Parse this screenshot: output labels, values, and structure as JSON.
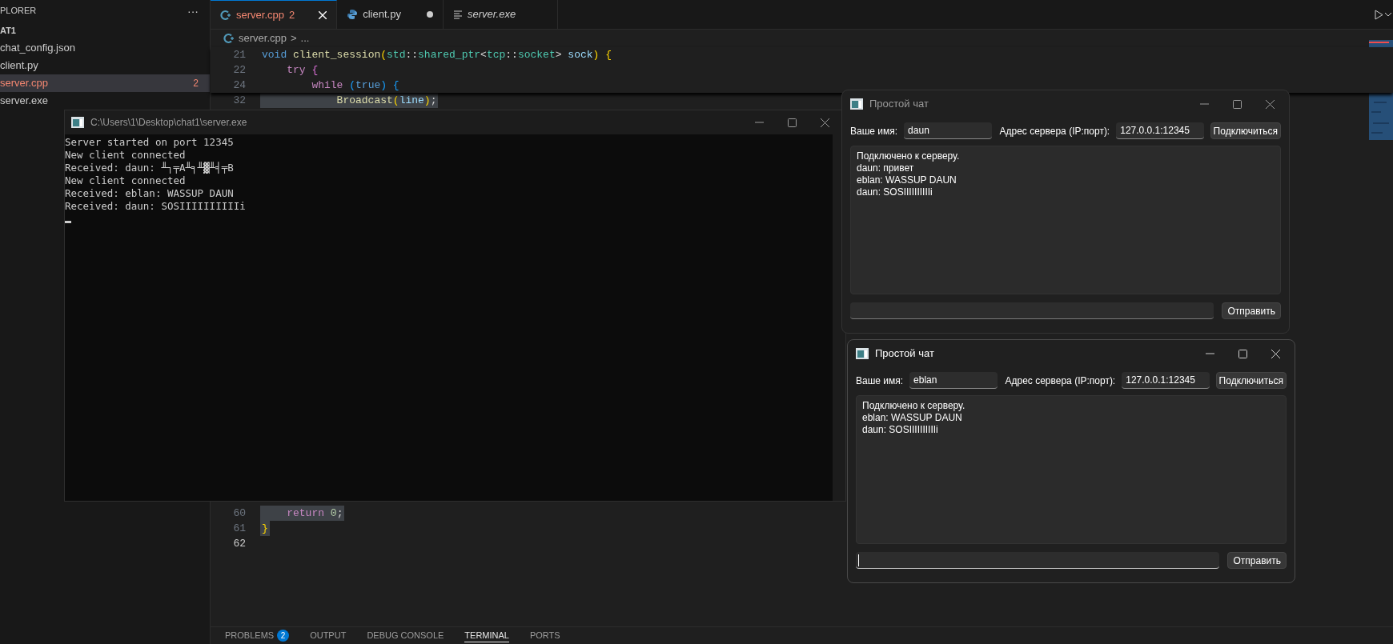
{
  "sidebar": {
    "title": "PLORER",
    "more_icon": "···",
    "section": "AT1",
    "items": [
      {
        "label": "chat_config.json",
        "selected": false
      },
      {
        "label": "client.py",
        "selected": false
      },
      {
        "label": "server.cpp",
        "selected": true,
        "badge": "2"
      },
      {
        "label": "server.exe",
        "selected": false
      }
    ]
  },
  "tabs": [
    {
      "label": "server.cpp",
      "kind": "cpp",
      "selected": true,
      "badge": "2",
      "modified": false,
      "preview": false
    },
    {
      "label": "client.py",
      "kind": "python",
      "selected": false,
      "modified": true,
      "preview": false
    },
    {
      "label": "server.exe",
      "kind": "binary",
      "selected": false,
      "modified": false,
      "preview": true
    }
  ],
  "breadcrumb": [
    "server.cpp",
    ">",
    "..."
  ],
  "code_top": [
    {
      "number": "21",
      "highlighted": false,
      "current": false,
      "tokens": [
        {
          "text": "void ",
          "kind": "kw"
        },
        {
          "text": "client_session",
          "kind": "fn"
        },
        {
          "text": "(",
          "kind": "b1"
        },
        {
          "text": "std",
          "kind": "type"
        },
        {
          "text": "::",
          "kind": "p"
        },
        {
          "text": "shared_ptr",
          "kind": "type"
        },
        {
          "text": "<",
          "kind": "p"
        },
        {
          "text": "tcp",
          "kind": "type"
        },
        {
          "text": "::",
          "kind": "p"
        },
        {
          "text": "socket",
          "kind": "type"
        },
        {
          "text": "> ",
          "kind": "p"
        },
        {
          "text": "sock",
          "kind": "param"
        },
        {
          "text": ") ",
          "kind": "b1"
        },
        {
          "text": "{",
          "kind": "b1"
        }
      ]
    },
    {
      "number": "22",
      "highlighted": false,
      "current": false,
      "tokens": [
        {
          "text": "    try ",
          "kind": "ctrl"
        },
        {
          "text": "{",
          "kind": "b2"
        }
      ]
    },
    {
      "number": "24",
      "highlighted": false,
      "current": false,
      "tokens": [
        {
          "text": "        while ",
          "kind": "ctrl"
        },
        {
          "text": "(",
          "kind": "b3"
        },
        {
          "text": "true",
          "kind": "kw"
        },
        {
          "text": ") ",
          "kind": "b3"
        },
        {
          "text": "{",
          "kind": "b3"
        }
      ]
    },
    {
      "number": "32",
      "highlighted": true,
      "current": false,
      "tokens": [
        {
          "text": "            Broadcast",
          "kind": "fn"
        },
        {
          "text": "(",
          "kind": "b1"
        },
        {
          "text": "line",
          "kind": "param"
        },
        {
          "text": ")",
          "kind": "b1"
        },
        {
          "text": ";",
          "kind": "p"
        }
      ]
    }
  ],
  "code_bottom": [
    {
      "number": "60",
      "highlighted": true,
      "current": false,
      "tokens": [
        {
          "text": "    return ",
          "kind": "ctrl"
        },
        {
          "text": "0",
          "kind": "num"
        },
        {
          "text": ";",
          "kind": "p"
        }
      ]
    },
    {
      "number": "61",
      "highlighted": true,
      "current": false,
      "tokens": [
        {
          "text": "}",
          "kind": "b1"
        }
      ]
    },
    {
      "number": "62",
      "current": true
    }
  ],
  "panel_tabs": [
    {
      "label": "PROBLEMS",
      "selected": false,
      "badge": "2"
    },
    {
      "label": "OUTPUT",
      "selected": false
    },
    {
      "label": "DEBUG CONSOLE",
      "selected": false
    },
    {
      "label": "TERMINAL",
      "selected": true
    },
    {
      "label": "PORTS",
      "selected": false
    }
  ],
  "console": {
    "title": "C:\\Users\\1\\Desktop\\chat1\\server.exe",
    "lines": [
      "Server started on port 12345",
      "New client connected",
      "Received: daun: ╨┐╤А╨╕╨▓╨╡╤В",
      "New client connected",
      "Received: eblan: WASSUP DAUN",
      "Received: daun: SOSIIIIIIIIIIi"
    ]
  },
  "chat_windows": [
    {
      "title": "Простой чат",
      "active": false,
      "name_label": "Ваше имя:",
      "name_value": "daun",
      "address_label": "Адрес сервера (IP:порт):",
      "address_value": "127.0.0.1:12345",
      "connect_button": "Подключиться",
      "messages": [
        "Подключено к серверу.",
        "daun: привет",
        "eblan: WASSUP DAUN",
        "daun: SOSIIIIIIIIIIi"
      ],
      "message_input": {
        "focused": false
      },
      "send_button": "Отправить"
    },
    {
      "title": "Простой чат",
      "active": true,
      "name_label": "Ваше имя:",
      "name_value": "eblan",
      "address_label": "Адрес сервера (IP:порт):",
      "address_value": "127.0.0.1:12345",
      "connect_button": "Подключиться",
      "messages": [
        "Подключено к серверу.",
        "eblan: WASSUP DAUN",
        "daun: SOSIIIIIIIIIIi"
      ],
      "message_input": {
        "focused": true
      },
      "send_button": "Отправить"
    }
  ]
}
